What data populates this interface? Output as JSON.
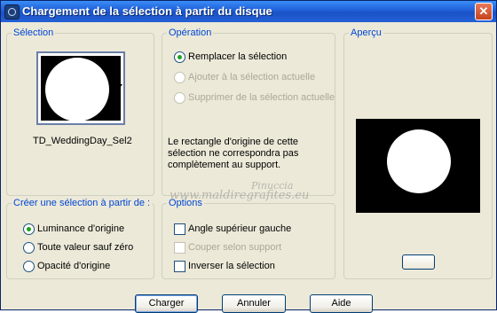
{
  "window": {
    "title": "Chargement de la sélection à partir du disque",
    "close_glyph": "✕"
  },
  "selection": {
    "legend": "Sélection",
    "filename": "TD_WeddingDay_Sel2"
  },
  "operation": {
    "legend": "Opération",
    "options": [
      {
        "label": "Remplacer la sélection",
        "selected": true,
        "enabled": true
      },
      {
        "label": "Ajouter à la sélection actuelle",
        "selected": false,
        "enabled": false
      },
      {
        "label": "Supprimer de la sélection actuelle",
        "selected": false,
        "enabled": false
      }
    ],
    "note": [
      "Le rectangle d'origine de cette",
      "sélection ne correspondra pas",
      "complètement au support."
    ]
  },
  "preview": {
    "legend": "Aperçu"
  },
  "create_from": {
    "legend": "Créer une sélection à partir de :",
    "options": [
      {
        "label": "Luminance d'origine",
        "selected": true
      },
      {
        "label": "Toute valeur sauf zéro",
        "selected": false
      },
      {
        "label": "Opacité d'origine",
        "selected": false
      }
    ]
  },
  "options": {
    "legend": "Options",
    "items": [
      {
        "label": "Angle supérieur gauche",
        "checked": false,
        "enabled": true
      },
      {
        "label": "Couper selon support",
        "checked": false,
        "enabled": false
      },
      {
        "label": "Inverser la sélection",
        "checked": false,
        "enabled": true
      }
    ]
  },
  "watermark": {
    "line1": "Pinuccia",
    "line2": "www.maldiregrafites.eu"
  },
  "buttons": {
    "ok": "Charger",
    "cancel": "Annuler",
    "help": "Aide"
  }
}
